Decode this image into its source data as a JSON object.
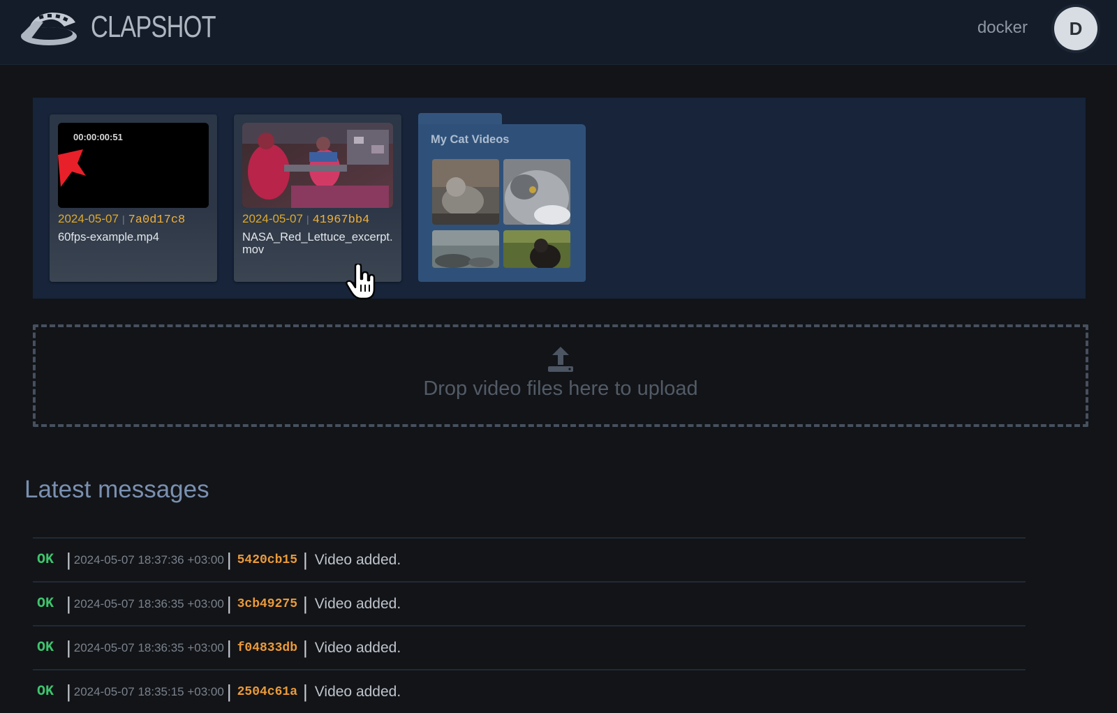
{
  "header": {
    "brand": "CLAPSHOT",
    "username": "docker",
    "avatar_initial": "D"
  },
  "videos": [
    {
      "timecode": "00:00:00:51",
      "date": "2024-05-07",
      "hash": "7a0d17c8",
      "name": "60fps-example.mp4"
    },
    {
      "timecode": "",
      "date": "2024-05-07",
      "hash": "41967bb4",
      "name": "NASA_Red_Lettuce_excerpt.mov"
    }
  ],
  "folder": {
    "title": "My Cat Videos"
  },
  "upload": {
    "text": "Drop video files here to upload"
  },
  "messages": {
    "heading": "Latest messages",
    "items": [
      {
        "status": "OK",
        "timestamp": "2024-05-07 18:37:36 +03:00",
        "hash": "5420cb15",
        "text": "Video added."
      },
      {
        "status": "OK",
        "timestamp": "2024-05-07 18:36:35 +03:00",
        "hash": "3cb49275",
        "text": "Video added."
      },
      {
        "status": "OK",
        "timestamp": "2024-05-07 18:36:35 +03:00",
        "hash": "f04833db",
        "text": "Video added."
      },
      {
        "status": "OK",
        "timestamp": "2024-05-07 18:35:15 +03:00",
        "hash": "2504c61a",
        "text": "Video added."
      }
    ]
  },
  "colors": {
    "background": "#121418",
    "header": "#141c29",
    "accent_date": "#e0a92b",
    "ok": "#3ec46d",
    "hash": "#ea9a3a",
    "folder": "#2f5179"
  }
}
